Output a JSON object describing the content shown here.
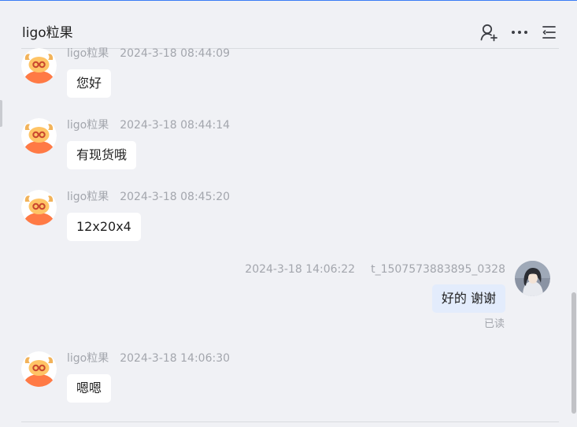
{
  "header": {
    "title": "ligo粒果",
    "icons": [
      "add-contact-icon",
      "more-icon",
      "menu-icon"
    ]
  },
  "colors": {
    "accent": "#3a7cf5",
    "background": "#f0f1f5",
    "bubble_incoming": "#ffffff",
    "bubble_outgoing": "#e3ecfc",
    "meta_text": "#a3a6ad"
  },
  "messages": [
    {
      "direction": "incoming",
      "sender": "ligo粒果",
      "time": "2024-3-18 08:44:09",
      "text": "您好"
    },
    {
      "direction": "incoming",
      "sender": "ligo粒果",
      "time": "2024-3-18 08:44:14",
      "text": "有现货哦"
    },
    {
      "direction": "incoming",
      "sender": "ligo粒果",
      "time": "2024-3-18 08:45:20",
      "text": "12x20x4"
    },
    {
      "direction": "outgoing",
      "sender": "t_1507573883895_0328",
      "time": "2024-3-18 14:06:22",
      "text": "好的 谢谢",
      "status": "已读"
    },
    {
      "direction": "incoming",
      "sender": "ligo粒果",
      "time": "2024-3-18 14:06:30",
      "text": "嗯嗯"
    }
  ]
}
